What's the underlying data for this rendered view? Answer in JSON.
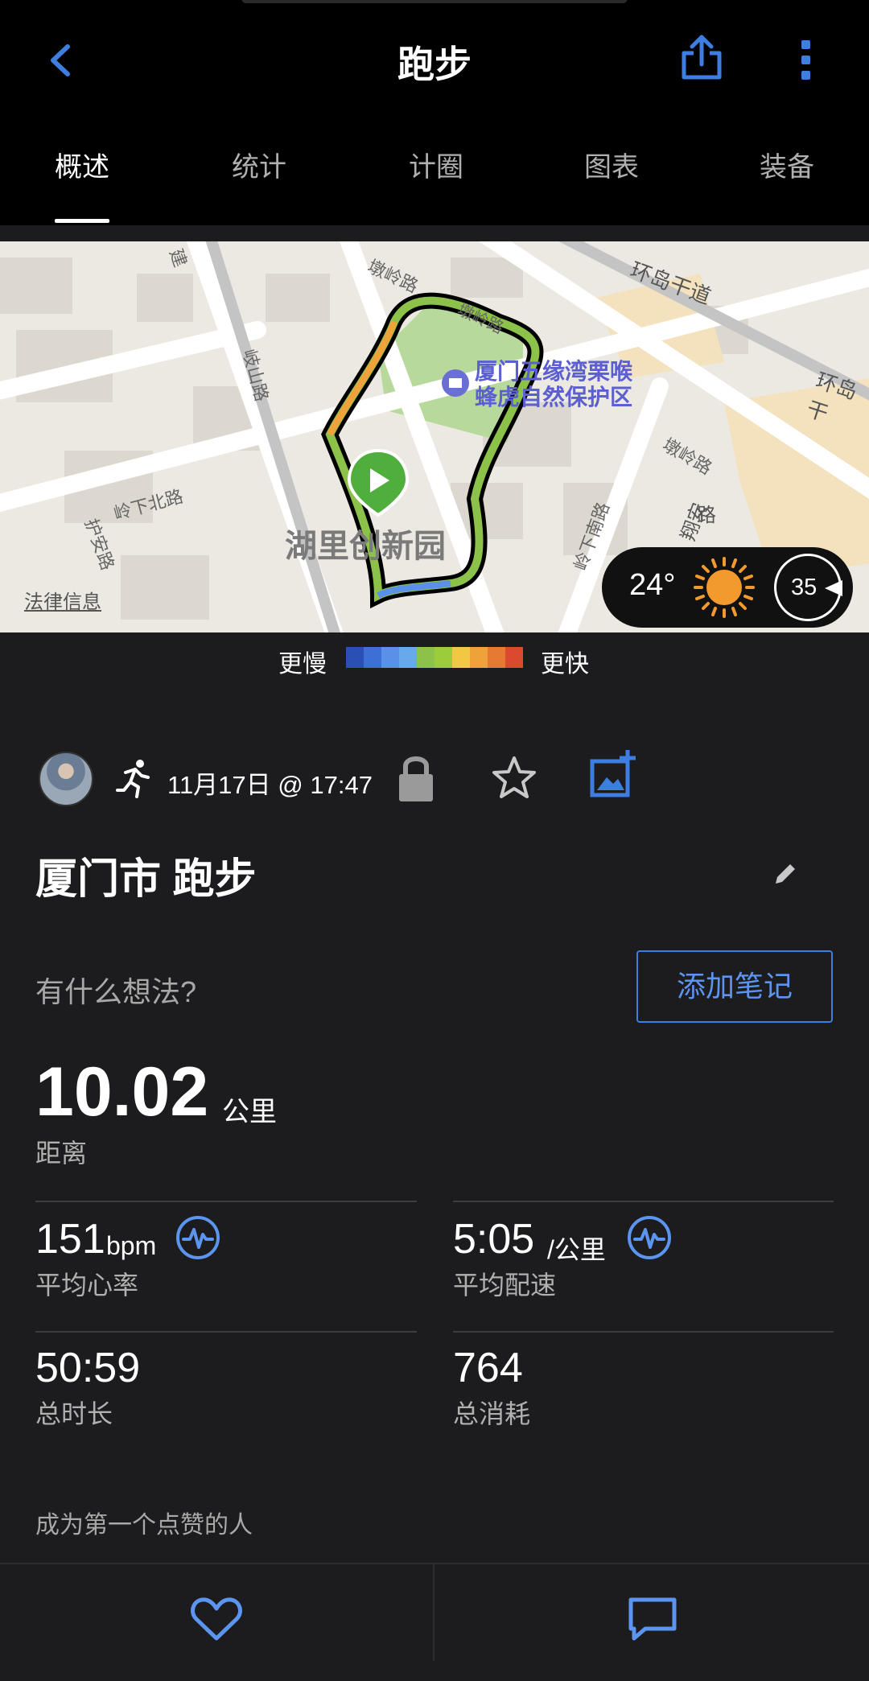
{
  "header": {
    "title": "跑步",
    "tabs": [
      {
        "label": "概述",
        "active": true
      },
      {
        "label": "统计",
        "active": false
      },
      {
        "label": "计圈",
        "active": false
      },
      {
        "label": "图表",
        "active": false
      },
      {
        "label": "装备",
        "active": false
      }
    ]
  },
  "map": {
    "legal_link": "法律信息",
    "labels": {
      "park_line1": "厦门五缘湾栗喉",
      "park_line2": "蜂虎自然保护区",
      "area": "湖里创新园",
      "road_huandao": "环岛干道",
      "road_huandao_right": "环岛干",
      "road_qishan": "岐山路",
      "road_lingxiabei": "岭下北路",
      "road_hu_an": "护安路",
      "road_dunling_top": "墩岭路",
      "road_dunling_inner": "墩岭路",
      "road_dunling_right": "墩岭路",
      "road_lingxianan": "岭下南路",
      "road_jian": "建",
      "road_xiangan": "翔安",
      "road_right": "路"
    },
    "weather": {
      "temperature": "24°",
      "wind_speed": "35"
    }
  },
  "pace_legend": {
    "slow_label": "更慢",
    "fast_label": "更快",
    "colors": [
      "#2a4fb5",
      "#3d6fd6",
      "#5a90e8",
      "#67a9ea",
      "#8cc24a",
      "#9ccc3c",
      "#f2c744",
      "#f0a23a",
      "#e67a32",
      "#d94a2e"
    ]
  },
  "activity": {
    "date": "11月17日 @ 17:47",
    "title": "厦门市 跑步",
    "thoughts_prompt": "有什么想法?",
    "add_note_label": "添加笔记"
  },
  "distance": {
    "value": "10.02",
    "unit": "公里",
    "label": "距离"
  },
  "stats": {
    "heart_rate": {
      "value": "151",
      "unit": "bpm",
      "label": "平均心率"
    },
    "pace": {
      "value": "5:05",
      "unit": "/公里",
      "label": "平均配速"
    },
    "duration": {
      "value": "50:59",
      "label": "总时长"
    },
    "calories": {
      "value": "764",
      "label": "总消耗"
    }
  },
  "social": {
    "likes_prompt": "成为第一个点赞的人"
  },
  "colors": {
    "accent": "#3e7ee0",
    "background": "#1c1c1e",
    "header_bg": "#000000"
  }
}
